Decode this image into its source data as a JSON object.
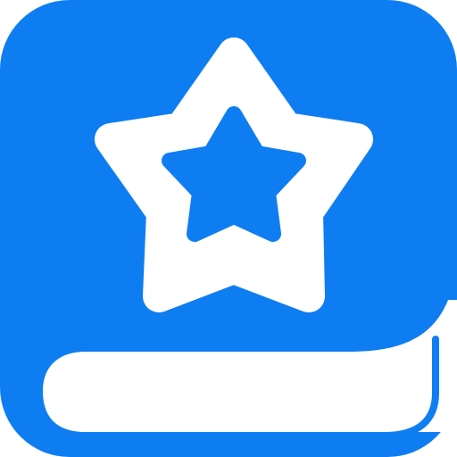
{
  "icon": {
    "name": "star-book-app-icon",
    "depicts": "book-with-star-icon",
    "colors": {
      "background": "#ffffff",
      "tile": "#0f7df2",
      "glyph": "#ffffff"
    }
  }
}
